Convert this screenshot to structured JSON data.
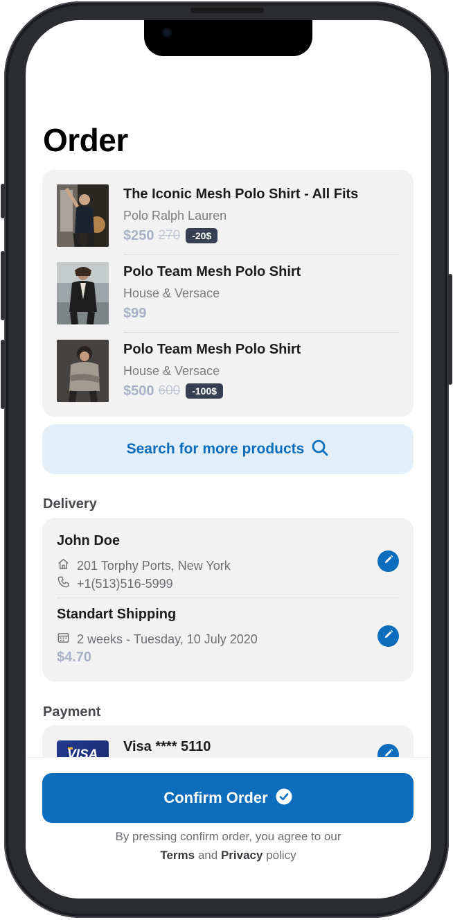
{
  "header": {
    "title": "Order"
  },
  "products": [
    {
      "name": "The Iconic Mesh Polo Shirt - All Fits",
      "brand": "Polo Ralph Lauren",
      "price": "$250",
      "old_price": "270",
      "badge": "-20$"
    },
    {
      "name": "Polo Team Mesh Polo Shirt",
      "brand": "House & Versace",
      "price": "$99",
      "old_price": "",
      "badge": ""
    },
    {
      "name": "Polo Team Mesh Polo Shirt",
      "brand": "House & Versace",
      "price": "$500",
      "old_price": "600",
      "badge": "-100$"
    }
  ],
  "search": {
    "label": "Search for more products",
    "icon": "search-icon"
  },
  "delivery": {
    "section_title": "Delivery",
    "address": {
      "name": "John Doe",
      "street": "201 Torphy Ports, New York",
      "phone": "+1(513)516-5999",
      "street_icon": "home-icon",
      "phone_icon": "phone-icon"
    },
    "shipping": {
      "name": "Standart Shipping",
      "eta": "2 weeks - Tuesday, 10 July 2020",
      "price": "$4.70",
      "icon": "calendar-icon"
    }
  },
  "payment": {
    "section_title": "Payment",
    "card": {
      "brand_logo": "VISA",
      "label": "Visa **** 5110"
    }
  },
  "footer": {
    "confirm_label": "Confirm Order",
    "terms_prefix": "By pressing confirm order, you agree to our",
    "terms_link": "Terms",
    "terms_and": "and",
    "privacy_link": "Privacy",
    "terms_suffix": "policy"
  },
  "colors": {
    "accent": "#0b6dbb",
    "accent_light": "#e2eef8",
    "price": "#a9b1c6",
    "badge_bg": "#364050",
    "card_bg": "#f2f2f3"
  }
}
